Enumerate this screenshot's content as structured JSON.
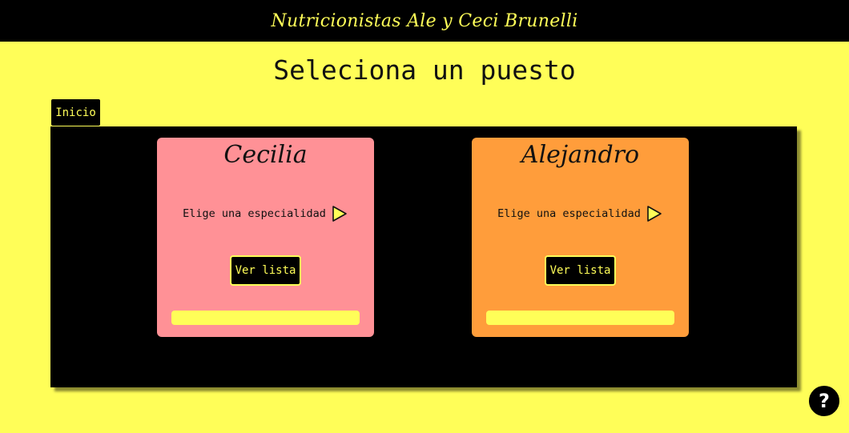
{
  "header": {
    "brand": "Nutricionistas Ale y Ceci Brunelli"
  },
  "main": {
    "title": "Seleciona un puesto",
    "home_button": "Inicio",
    "cards": [
      {
        "name": "Cecilia",
        "specialty_prompt": "Elige una especialidad",
        "list_button": "Ver lista",
        "color": "#ff9196"
      },
      {
        "name": "Alejandro",
        "specialty_prompt": "Elige una especialidad",
        "list_button": "Ver lista",
        "color": "#ff9d3b"
      }
    ]
  },
  "help": {
    "label": "?"
  },
  "colors": {
    "background": "#fffe58",
    "panel": "#000000",
    "accent": "#fffe58"
  },
  "icons": {
    "specialty_toggle": "play-triangle-icon",
    "help": "question-mark-icon"
  }
}
